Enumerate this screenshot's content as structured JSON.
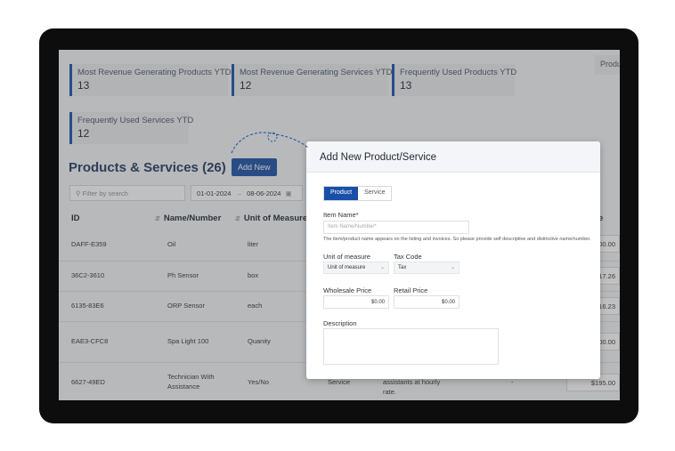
{
  "stats": [
    {
      "label": "Most Revenue Generating Products YTD",
      "value": "13"
    },
    {
      "label": "Most Revenue Generating Services YTD",
      "value": "12"
    },
    {
      "label": "Frequently Used Products YTD",
      "value": "13"
    },
    {
      "label": "Frequently Used Services YTD",
      "value": "12"
    }
  ],
  "top_right_tab": "Produ",
  "page": {
    "title": "Products & Services",
    "count": "(26)",
    "add_button": "Add New"
  },
  "filter": {
    "placeholder": "Filter by search",
    "date_from": "01-01-2024",
    "arrow": "→",
    "date_to": "08-06-2024"
  },
  "table": {
    "headers": [
      "ID",
      "Name/Number",
      "Unit of Measure"
    ],
    "partial_header": "e",
    "rows": [
      {
        "id": "DAFF-E359",
        "name": "Oil",
        "unit": "liter",
        "amount": "00.00"
      },
      {
        "id": "36C2-3610",
        "name": "Ph Sensor",
        "unit": "box",
        "amount": "17.26"
      },
      {
        "id": "6135-83E6",
        "name": "ORP Sensor",
        "unit": "each",
        "amount": "16.23"
      },
      {
        "id": "EAE3-CFC8",
        "name": "Spa Light 100",
        "unit": "Quanity",
        "amount": "00.00"
      },
      {
        "id": "6627-49ED",
        "name_line1": "Technician With",
        "name_line2": "Assistance",
        "unit": "Yes/No",
        "type": "Service",
        "desc_line1": "assistants at hourly",
        "desc_line2": "rate.",
        "dash": "-",
        "amount": "$195.00"
      }
    ]
  },
  "modal": {
    "title": "Add New Product/Service",
    "tabs": [
      "Product",
      "Service"
    ],
    "item_name_label": "Item Name*",
    "item_name_placeholder": "Item Name/Number*",
    "hint": "The item/product name appears on the listing and invoices. So please provide self descriptive and distinctive name/number.",
    "unit_label": "Unit of measure",
    "unit_value": "Unit of measure",
    "tax_label": "Tax Code",
    "tax_value": "Tax",
    "wholesale_label": "Wholesale Price",
    "wholesale_value": "$0.00",
    "retail_label": "Retail Price",
    "retail_value": "$0.00",
    "description_label": "Description"
  },
  "colors": {
    "accent": "#1a4fa8",
    "frame": "#0d0d0d"
  }
}
